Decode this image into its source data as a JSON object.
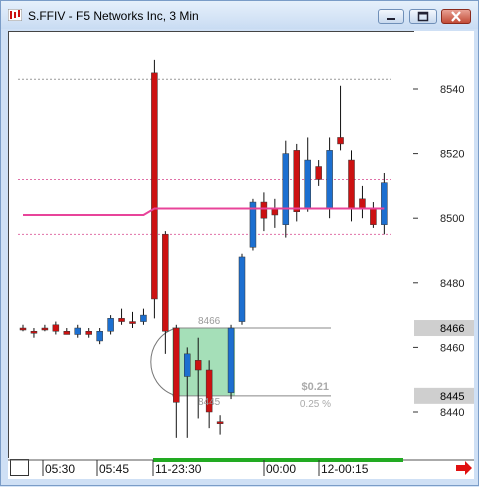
{
  "window": {
    "title": "S.FFIV - F5 Networks Inc, 3 Min"
  },
  "chart_data": {
    "type": "candlestick",
    "y_ticks": [
      "8540",
      "8520",
      "8500",
      "8480",
      "8460",
      "8440"
    ],
    "y_tick_values": [
      8540,
      8520,
      8500,
      8480,
      8460,
      8440
    ],
    "ylim": [
      8430,
      8555
    ],
    "x_labels": [
      "05:30",
      "05:45",
      "11-23:30",
      "00:00",
      "12-00:15"
    ],
    "price_markers": [
      {
        "label": "8466",
        "value": 8466
      },
      {
        "label": "8445",
        "value": 8445
      }
    ],
    "measure": {
      "top_label": "8466",
      "bottom_label": "8445",
      "change_label": "$0.21",
      "percent_label": "0.25 %"
    },
    "candles": [
      {
        "o": 8466,
        "h": 8467,
        "l": 8465,
        "c": 8466,
        "color": "#cc1111"
      },
      {
        "o": 8465,
        "h": 8466,
        "l": 8463,
        "c": 8465,
        "color": "#cc1111"
      },
      {
        "o": 8466,
        "h": 8467,
        "l": 8465,
        "c": 8466,
        "color": "#cc1111"
      },
      {
        "o": 8467,
        "h": 8468,
        "l": 8464,
        "c": 8465,
        "color": "#cc1111"
      },
      {
        "o": 8465,
        "h": 8466,
        "l": 8464,
        "c": 8464,
        "color": "#cc1111"
      },
      {
        "o": 8464,
        "h": 8467,
        "l": 8463,
        "c": 8466,
        "color": "#1c6fd0"
      },
      {
        "o": 8465,
        "h": 8466,
        "l": 8463,
        "c": 8464,
        "color": "#cc1111"
      },
      {
        "o": 8462,
        "h": 8466,
        "l": 8461,
        "c": 8465,
        "color": "#1c6fd0"
      },
      {
        "o": 8465,
        "h": 8470,
        "l": 8464,
        "c": 8469,
        "color": "#1c6fd0"
      },
      {
        "o": 8469,
        "h": 8472,
        "l": 8467,
        "c": 8468,
        "color": "#cc1111"
      },
      {
        "o": 8468,
        "h": 8471,
        "l": 8466,
        "c": 8468,
        "color": "#cc1111"
      },
      {
        "o": 8468,
        "h": 8472,
        "l": 8467,
        "c": 8470,
        "color": "#1c6fd0"
      },
      {
        "o": 8545,
        "h": 8549,
        "l": 8469,
        "c": 8475,
        "color": "#cc1111"
      },
      {
        "o": 8495,
        "h": 8496,
        "l": 8458,
        "c": 8465,
        "color": "#cc1111"
      },
      {
        "o": 8466,
        "h": 8467,
        "l": 8432,
        "c": 8443,
        "color": "#cc1111"
      },
      {
        "o": 8451,
        "h": 8460,
        "l": 8432,
        "c": 8458,
        "color": "#1c6fd0"
      },
      {
        "o": 8456,
        "h": 8463,
        "l": 8438,
        "c": 8453,
        "color": "#cc1111"
      },
      {
        "o": 8453,
        "h": 8456,
        "l": 8435,
        "c": 8440,
        "color": "#cc1111"
      },
      {
        "o": 8437,
        "h": 8439,
        "l": 8433,
        "c": 8437,
        "color": "#cc1111"
      },
      {
        "o": 8446,
        "h": 8467,
        "l": 8444,
        "c": 8466,
        "color": "#1c6fd0"
      },
      {
        "o": 8468,
        "h": 8489,
        "l": 8467,
        "c": 8488,
        "color": "#1c6fd0"
      },
      {
        "o": 8491,
        "h": 8506,
        "l": 8490,
        "c": 8505,
        "color": "#1c6fd0"
      },
      {
        "o": 8505,
        "h": 8508,
        "l": 8496,
        "c": 8500,
        "color": "#cc1111"
      },
      {
        "o": 8503,
        "h": 8506,
        "l": 8497,
        "c": 8501,
        "color": "#cc1111"
      },
      {
        "o": 8498,
        "h": 8524,
        "l": 8494,
        "c": 8520,
        "color": "#1c6fd0"
      },
      {
        "o": 8521,
        "h": 8523,
        "l": 8499,
        "c": 8502,
        "color": "#cc1111"
      },
      {
        "o": 8503,
        "h": 8525,
        "l": 8502,
        "c": 8518,
        "color": "#1c6fd0"
      },
      {
        "o": 8516,
        "h": 8518,
        "l": 8510,
        "c": 8512,
        "color": "#cc1111"
      },
      {
        "o": 8503,
        "h": 8525,
        "l": 8500,
        "c": 8521,
        "color": "#1c6fd0"
      },
      {
        "o": 8525,
        "h": 8541,
        "l": 8521,
        "c": 8523,
        "color": "#cc1111"
      },
      {
        "o": 8518,
        "h": 8521,
        "l": 8499,
        "c": 8503,
        "color": "#cc1111"
      },
      {
        "o": 8506,
        "h": 8510,
        "l": 8500,
        "c": 8503,
        "color": "#cc1111"
      },
      {
        "o": 8503,
        "h": 8505,
        "l": 8497,
        "c": 8498,
        "color": "#cc1111"
      },
      {
        "o": 8498,
        "h": 8514,
        "l": 8495,
        "c": 8511,
        "color": "#1c6fd0"
      }
    ],
    "reference_lines": [
      {
        "value": 8543,
        "color": "#999999",
        "style": "dotted"
      },
      {
        "value": 8512,
        "color": "#e070a8",
        "style": "dotted"
      },
      {
        "value": 8495,
        "color": "#e070a8",
        "style": "dotted"
      }
    ],
    "moving_line": {
      "color": "#e8449a",
      "points": [
        [
          0,
          8501
        ],
        [
          11,
          8501
        ],
        [
          12,
          8503
        ],
        [
          33,
          8503
        ]
      ]
    },
    "grid": false
  },
  "colors": {
    "plot_bg": "#ffffff",
    "window_bg": "#cfe0f5",
    "marker_bg": "#cfcfcf",
    "measure_fill": "#7fd29a",
    "timeline_bar": "#22aa22",
    "arrow": "#e01010"
  },
  "icons": {
    "app": "chart-app-icon",
    "minimize": "minimize-icon",
    "maximize": "maximize-icon",
    "close": "close-icon",
    "scroll": "arrow-right-icon"
  }
}
